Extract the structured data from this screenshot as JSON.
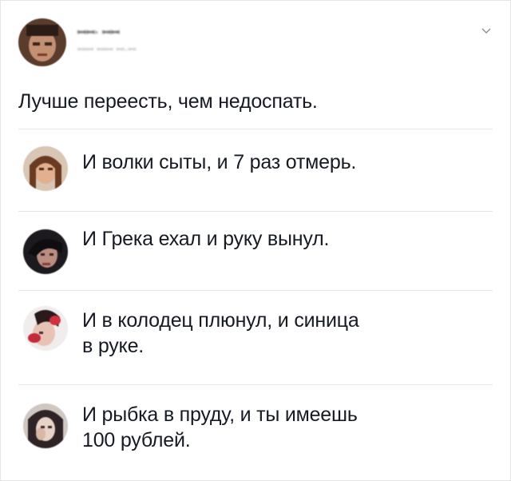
{
  "tweet": {
    "author_name": "ꟷꟷ· ꟷꟷ",
    "author_handle": "ꟷꟷ ꟷꟷ ꟷ·ꟷ",
    "text": "Лучше переесть, чем недоспать.",
    "menu_icon": "chevron-down-icon"
  },
  "replies": [
    {
      "text": "И волки сыты, и 7 раз отмерь."
    },
    {
      "text": "И Грека ехал и руку вынул."
    },
    {
      "text": "И в колодец плюнул, и синица\nв руке."
    },
    {
      "text": "И рыбка в пруду, и ты имеешь\n100 рублей."
    }
  ],
  "colors": {
    "text": "#161a22",
    "divider": "#e3e5e8",
    "muted": "#8a8d91"
  }
}
